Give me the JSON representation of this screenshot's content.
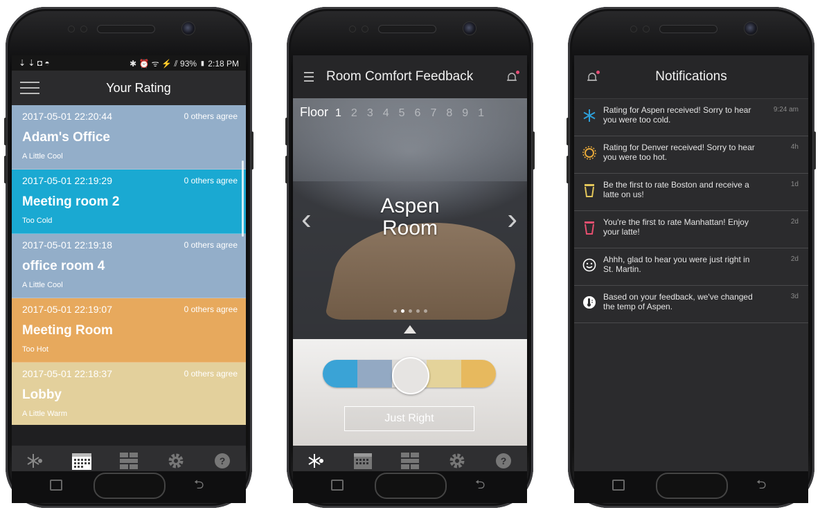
{
  "colors": {
    "too_cold": "#3aa3d6",
    "cool_blue": "#8fa9c4",
    "just_right": "#dddbd8",
    "little_warm": "#e4d08f",
    "too_hot": "#e8aa5c",
    "slider": [
      "#3aa3d6",
      "#93a9c3",
      "#dddbd8",
      "#e4d39a",
      "#e7b95e"
    ]
  },
  "phone1": {
    "status": {
      "left_icons": "⇣ ⇣ ◘ ◓",
      "right": "✱ ⏰ ᯤ ⚡ ⫽ 93% ▮ 2:18 PM"
    },
    "title": "Your Rating",
    "ratings": [
      {
        "timestamp": "2017-05-01 22:20:44",
        "agree": "0 others agree",
        "room": "Adam's Office",
        "rating": "A Little Cool",
        "color": "#93aec9"
      },
      {
        "timestamp": "2017-05-01 22:19:29",
        "agree": "0 others agree",
        "room": "Meeting room 2",
        "rating": "Too Cold",
        "color": "#1aa9d2"
      },
      {
        "timestamp": "2017-05-01 22:19:18",
        "agree": "0 others agree",
        "room": "office room 4",
        "rating": "A Little Cool",
        "color": "#93aec9"
      },
      {
        "timestamp": "2017-05-01 22:19:07",
        "agree": "0 others agree",
        "room": "Meeting Room",
        "rating": "Too Hot",
        "color": "#e7a95d"
      },
      {
        "timestamp": "2017-05-01 22:18:37",
        "agree": "0 others agree",
        "room": "Lobby",
        "rating": "A Little Warm",
        "color": "#e3d09c"
      }
    ],
    "tabs": [
      "snowflake-sun-icon",
      "calendar-icon",
      "floorplan-icon",
      "gear-icon",
      "help-icon"
    ]
  },
  "phone2": {
    "title": "Room Comfort Feedback",
    "floor_label": "Floor",
    "floors": [
      "1",
      "2",
      "3",
      "4",
      "5",
      "6",
      "7",
      "8",
      "9",
      "1"
    ],
    "selected_floor": "1",
    "room_line1": "Aspen",
    "room_line2": "Room",
    "prev": "‹",
    "next": "›",
    "slide_count": 5,
    "active_slide": 1,
    "rating_label": "Just Right",
    "tabs": [
      "snowflake-sun-icon",
      "calendar-icon",
      "floorplan-icon",
      "gear-icon",
      "help-icon"
    ]
  },
  "phone3": {
    "title": "Notifications",
    "notifications": [
      {
        "icon": "snowflake-icon",
        "text": "Rating for Aspen received! Sorry to hear you were too cold.",
        "time": "9:24 am",
        "color": "#2d9fd9"
      },
      {
        "icon": "sun-icon",
        "text": "Rating for Denver received! Sorry to hear you were too hot.",
        "time": "4h",
        "color": "#e8a93a"
      },
      {
        "icon": "cup-icon",
        "text": "Be the first to rate Boston and receive a latte on us!",
        "time": "1d",
        "color": "#e3c65a"
      },
      {
        "icon": "cup-icon",
        "text": "You're the first to rate Manhattan! Enjoy your latte!",
        "time": "2d",
        "color": "#e84f6f"
      },
      {
        "icon": "smiley-icon",
        "text": "Ahhh, glad to hear you were just right in St. Martin.",
        "time": "2d",
        "color": "#ffffff"
      },
      {
        "icon": "thermometer-icon",
        "text": "Based on your feedback, we've changed the temp of Aspen.",
        "time": "3d",
        "color": "#ffffff"
      }
    ]
  }
}
